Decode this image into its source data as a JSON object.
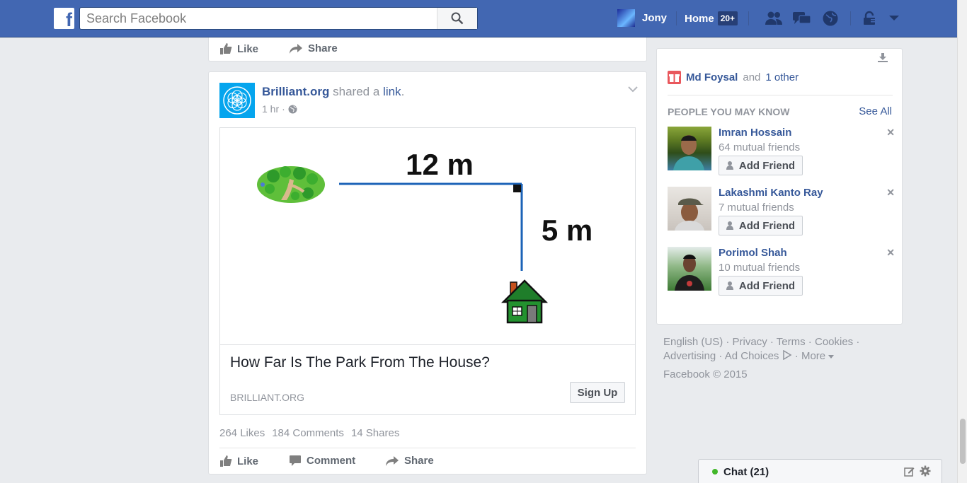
{
  "search": {
    "placeholder": "Search Facebook"
  },
  "nav": {
    "profile_name": "Jony",
    "home_label": "Home",
    "home_badge": "20+"
  },
  "prev_post": {
    "like": "Like",
    "share": "Share"
  },
  "post": {
    "author": "Brilliant.org",
    "shared_text": "shared a",
    "link_word": "link",
    "period": ".",
    "time": "1 hr",
    "dot": "·",
    "image_labels": {
      "horizontal_distance": "12 m",
      "vertical_distance": "5 m"
    },
    "link_title": "How Far Is The Park From The House?",
    "link_domain": "BRILLIANT.ORG",
    "signup": "Sign Up",
    "stats": {
      "likes": "264 Likes",
      "comments": "184 Comments",
      "shares": "14 Shares"
    },
    "actions": {
      "like": "Like",
      "comment": "Comment",
      "share": "Share"
    }
  },
  "sidebar": {
    "birthday_name": "Md Foysal",
    "birthday_and": "and",
    "birthday_other": "1 other",
    "pymk_title": "PEOPLE YOU MAY KNOW",
    "see_all": "See All",
    "people": [
      {
        "name": "Imran Hossain",
        "mutual": "64 mutual friends",
        "button": "Add Friend"
      },
      {
        "name": "Lakashmi Kanto Ray",
        "mutual": "7 mutual friends",
        "button": "Add Friend"
      },
      {
        "name": "Porimol Shah",
        "mutual": "10 mutual friends",
        "button": "Add Friend"
      }
    ]
  },
  "footer": {
    "links": [
      "English (US)",
      "Privacy",
      "Terms",
      "Cookies",
      "Advertising",
      "Ad Choices",
      "More"
    ],
    "copyright": "Facebook © 2015"
  },
  "chat": {
    "label": "Chat (21)"
  },
  "colors": {
    "brand": "#4267b2",
    "link": "#365899",
    "online": "#42b72a"
  }
}
